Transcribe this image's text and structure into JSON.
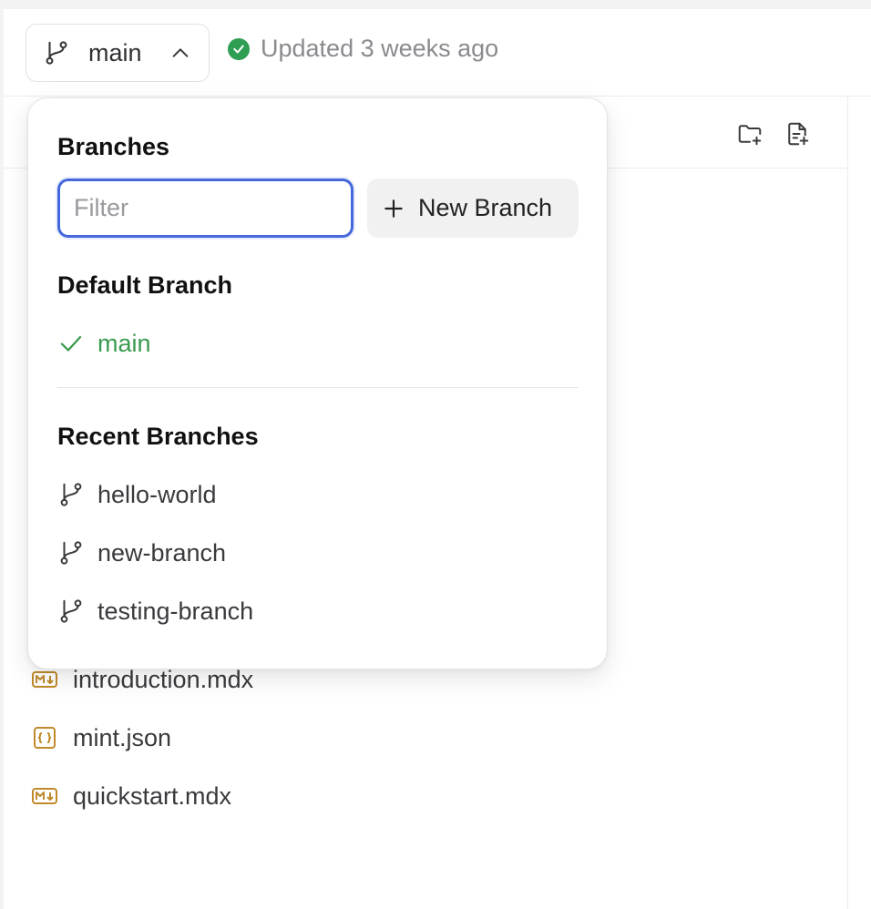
{
  "header": {
    "current_branch": "main",
    "status_text": "Updated 3 weeks ago"
  },
  "files": [
    {
      "name": "introduction.mdx",
      "icon": "markdown-icon"
    },
    {
      "name": "mint.json",
      "icon": "json-icon"
    },
    {
      "name": "quickstart.mdx",
      "icon": "markdown-icon"
    }
  ],
  "branch_menu": {
    "title": "Branches",
    "filter_placeholder": "Filter",
    "new_branch_label": "New Branch",
    "default_section_title": "Default Branch",
    "default_branch": "main",
    "recent_section_title": "Recent Branches",
    "recent_branches": [
      "hello-world",
      "new-branch",
      "testing-branch"
    ]
  },
  "colors": {
    "accent_focus": "#4568dc",
    "success": "#2e9e52",
    "active_branch": "#3a9a4e",
    "file_icon": "#c08a2a"
  }
}
